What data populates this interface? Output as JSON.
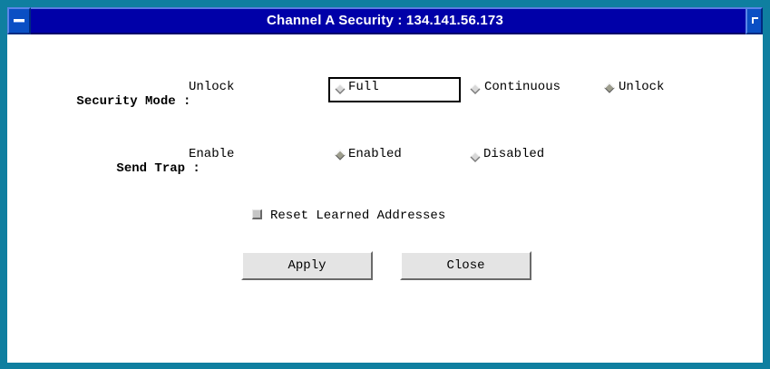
{
  "window": {
    "title": "Channel A Security : 134.141.56.173"
  },
  "security_mode": {
    "label": "Security Mode :",
    "current": "Unlock",
    "options": [
      "Full",
      "Continuous",
      "Unlock"
    ],
    "selected": "Unlock"
  },
  "send_trap": {
    "label": "Send Trap :",
    "current": "Enable",
    "options": [
      "Enabled",
      "Disabled"
    ],
    "selected": "Enabled"
  },
  "reset": {
    "label": "Reset Learned Addresses",
    "checked": false
  },
  "buttons": {
    "apply": "Apply",
    "close": "Close"
  },
  "colors": {
    "frame": "#0f7fa0",
    "titlebar": "#0000a8",
    "radio_on": "#9e9e8e",
    "radio_off": "#d8d8d8"
  }
}
